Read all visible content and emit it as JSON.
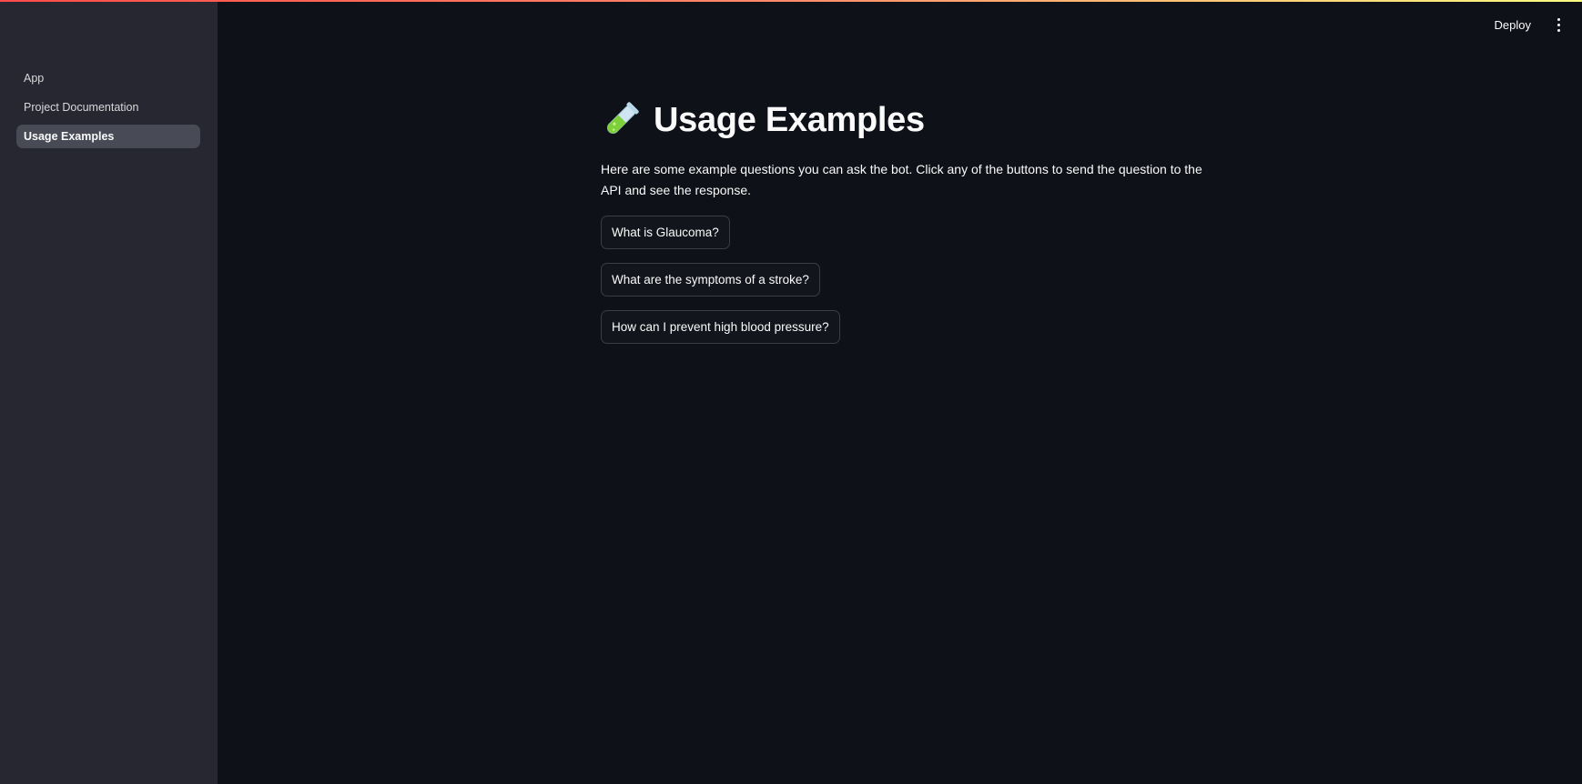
{
  "sidebar": {
    "items": [
      {
        "label": "App",
        "active": false
      },
      {
        "label": "Project Documentation",
        "active": false
      },
      {
        "label": "Usage Examples",
        "active": true
      }
    ]
  },
  "header": {
    "deploy_label": "Deploy",
    "menu_icon": "vertical-ellipsis-icon"
  },
  "main": {
    "title_icon": "test-tube-icon",
    "title": "Usage Examples",
    "intro": "Here are some example questions you can ask the bot. Click any of the buttons to send the question to the API and see the response.",
    "examples": [
      {
        "label": "What is Glaucoma?"
      },
      {
        "label": "What are the symptoms of a stroke?"
      },
      {
        "label": "How can I prevent high blood pressure?"
      }
    ]
  },
  "colors": {
    "background": "#0e1117",
    "sidebar": "#262730",
    "active_nav": "#484a55",
    "text": "#fafafa",
    "accent_gradient_start": "#ff4b4b",
    "accent_gradient_end": "#fffd80"
  }
}
